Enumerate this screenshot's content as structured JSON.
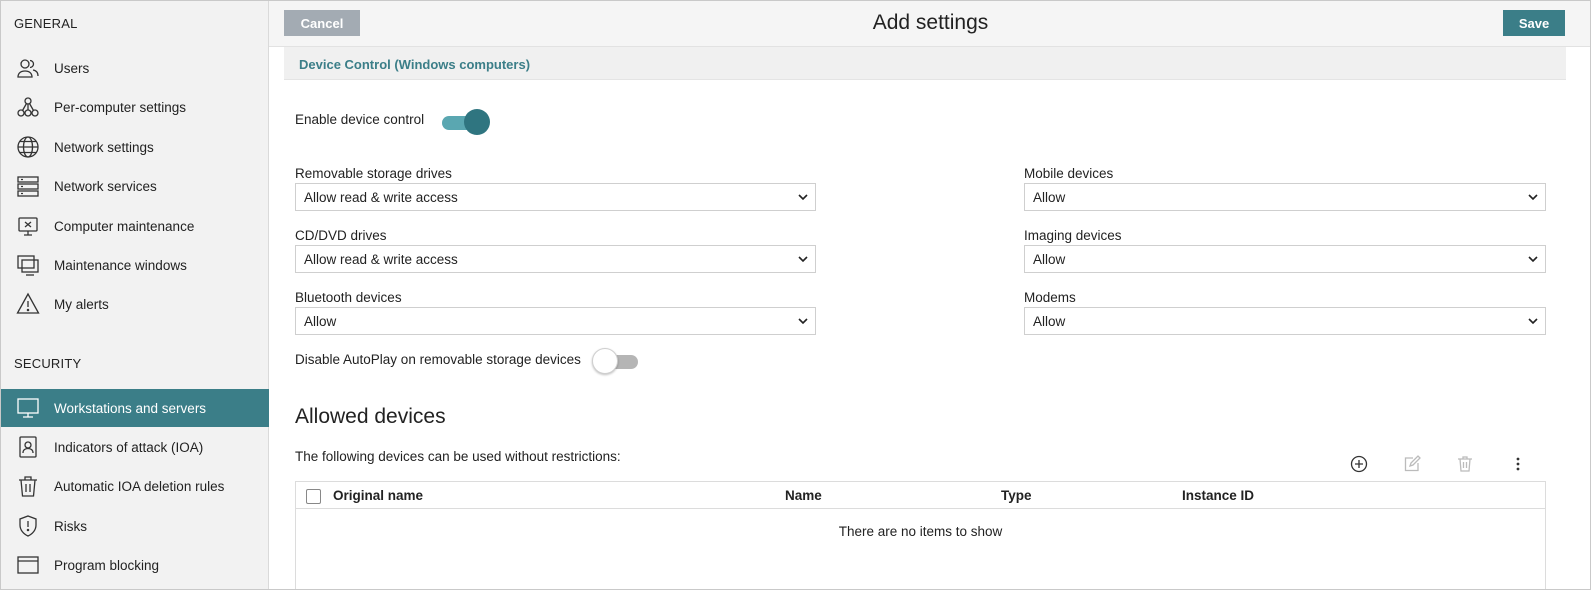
{
  "sidebar": {
    "general_title": "GENERAL",
    "security_title": "SECURITY",
    "general_items": [
      {
        "label": "Users",
        "icon": "users-icon"
      },
      {
        "label": "Per-computer settings",
        "icon": "hierarchy-icon"
      },
      {
        "label": "Network settings",
        "icon": "globe-icon"
      },
      {
        "label": "Network services",
        "icon": "server-icon"
      },
      {
        "label": "Computer maintenance",
        "icon": "monitor-x-icon"
      },
      {
        "label": "Maintenance windows",
        "icon": "windows-stack-icon"
      },
      {
        "label": "My alerts",
        "icon": "warning-icon"
      }
    ],
    "security_items": [
      {
        "label": "Workstations and servers",
        "icon": "desktop-icon",
        "active": true
      },
      {
        "label": "Indicators of attack (IOA)",
        "icon": "person-badge-icon"
      },
      {
        "label": "Automatic IOA deletion rules",
        "icon": "trash-icon"
      },
      {
        "label": "Risks",
        "icon": "shield-alert-icon"
      },
      {
        "label": "Program blocking",
        "icon": "window-icon"
      }
    ]
  },
  "header": {
    "cancel_label": "Cancel",
    "title": "Add settings",
    "save_label": "Save"
  },
  "device_control": {
    "section_title": "Device Control (Windows computers)",
    "enable_label": "Enable device control",
    "enable_on": true,
    "left_fields": [
      {
        "label": "Removable storage drives",
        "value": "Allow read & write access"
      },
      {
        "label": "CD/DVD drives",
        "value": "Allow read & write access"
      },
      {
        "label": "Bluetooth devices",
        "value": "Allow"
      }
    ],
    "right_fields": [
      {
        "label": "Mobile devices",
        "value": "Allow"
      },
      {
        "label": "Imaging devices",
        "value": "Allow"
      },
      {
        "label": "Modems",
        "value": "Allow"
      }
    ],
    "autoplay_label": "Disable AutoPlay on removable storage devices",
    "autoplay_on": false
  },
  "allowed": {
    "title": "Allowed devices",
    "description": "The following devices can be used without restrictions:",
    "columns": [
      "Original name",
      "Name",
      "Type",
      "Instance ID"
    ],
    "empty_text": "There are no items to show"
  },
  "colors": {
    "accent": "#3b7e88",
    "cancel": "#a3abb3",
    "sidebar_bg": "#f2f2f2"
  }
}
